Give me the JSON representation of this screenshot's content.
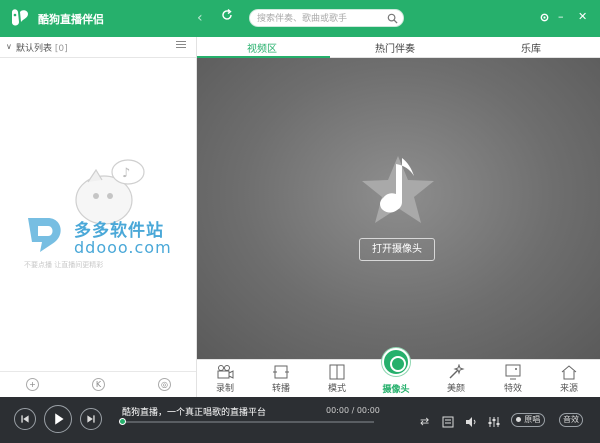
{
  "app": {
    "title": "酷狗直播伴侣"
  },
  "search": {
    "placeholder": "搜索伴奏、歌曲或歌手"
  },
  "left_panel": {
    "list_title": "默认列表",
    "list_count": "[0]",
    "watermark_name": "多多软件站",
    "watermark_url": "ddooo.com",
    "watermark_sub": "不要点播 让直播间更精彩"
  },
  "tabs": [
    {
      "label": "视频区",
      "active": true
    },
    {
      "label": "热门伴奏",
      "active": false
    },
    {
      "label": "乐库",
      "active": false
    }
  ],
  "video": {
    "open_camera_label": "打开摄像头"
  },
  "features": [
    {
      "label": "录制",
      "icon": "video-record-icon"
    },
    {
      "label": "转播",
      "icon": "relay-icon"
    },
    {
      "label": "模式",
      "icon": "layout-mode-icon"
    },
    {
      "label": "摄像头",
      "icon": "camera-icon",
      "active": true
    },
    {
      "label": "美颜",
      "icon": "magic-wand-icon"
    },
    {
      "label": "特效",
      "icon": "effects-icon"
    },
    {
      "label": "来源",
      "icon": "home-icon"
    }
  ],
  "player": {
    "song_title": "酷狗直播，一个真正唱歌的直播平台",
    "time": "00:00 / 00:00",
    "original_label": "原唱",
    "accompaniment_label": "音效",
    "progress": 0
  },
  "colors": {
    "accent": "#26b06c",
    "player_bg": "#2c2f33"
  }
}
